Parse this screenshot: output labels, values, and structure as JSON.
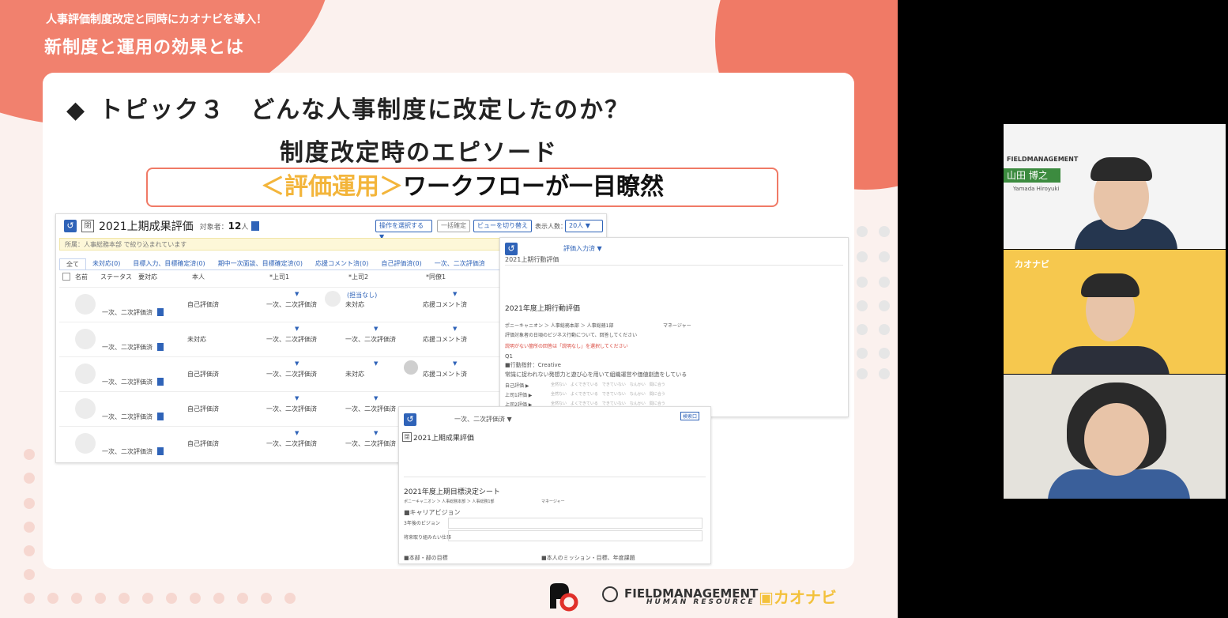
{
  "slide": {
    "header_sub": "人事評価制度改定と同時にカオナビを導入！",
    "header_title": "新制度と運用の効果とは",
    "topic_marker": "◆",
    "topic_title": "トピック３　どんな人事制度に改定したのか？",
    "topic_subtitle": "制度改定時のエピソード",
    "banner_highlight": "＜評価運用＞",
    "banner_text": "ワークフローが一目瞭然"
  },
  "screenshot_main": {
    "kanji": "閉",
    "title": "2021上期成果評価",
    "count_label": "対象者：",
    "count_value": "12",
    "count_unit": "人",
    "operation_select": "操作を選択する",
    "bulk_confirm": "一括確定",
    "view_switch": "ビューを切り替え",
    "display_count_label": "表示人数：",
    "display_count_value": "20人",
    "filter_text": "所属：人事総務本部 で絞り込まれています",
    "tabs": [
      "全て",
      "未対応(0)",
      "目標入力、目標確定済(0)",
      "期中一次面談、目標確定済(0)",
      "応援コメント済(0)",
      "自己評価済(0)",
      "一次、二次評価済"
    ],
    "headers": [
      "名前",
      "ステータス",
      "要対応",
      "本人",
      "*上司1",
      "*上司2",
      "*同僚1"
    ],
    "rows": [
      {
        "status": "一次、二次評価済",
        "self": "自己評価済",
        "boss1": "一次、二次評価済",
        "boss2_a": "(担当なし)",
        "boss2_b": "未対応",
        "peer": "応援コメント済"
      },
      {
        "status": "一次、二次評価済",
        "self": "未対応",
        "boss1": "一次、二次評価済",
        "boss2": "一次、二次評価済",
        "peer": "応援コメント済"
      },
      {
        "status": "一次、二次評価済",
        "self": "自己評価済",
        "boss1": "一次、二次評価済",
        "boss2": "未対応",
        "peer": "応援コメント済"
      },
      {
        "status": "一次、二次評価済",
        "self": "自己評価済",
        "boss1": "一次、二次評価済",
        "boss2": "一次、二次評価済",
        "peer": ""
      },
      {
        "status": "一次、二次評価済",
        "self": "自己評価済",
        "boss1": "一次、二次評価済",
        "boss2": "一次、二次評価済",
        "peer": ""
      }
    ]
  },
  "screenshot_behavior": {
    "status": "評価入力済",
    "sheet_label": "2021上期行動評価",
    "section_title": "2021年度上期行動評価",
    "org": "ポニーキャニオン ＞ 人事総務本部 ＞ 人事総務1部",
    "position": "マネージャー",
    "instruction": "評価対象者の日頃のビジネス行動について、回答してください",
    "red_note": "説明がない箇所の回答は「説明なし」を選択してください",
    "q_label": "Q1",
    "q_item": "■行動指針：Creative",
    "q_text": "常識に捉われない発想力と遊び心を用いて組織運営や価値創造をしている",
    "raters": [
      "自己評価 ▶",
      "上司1評価 ▶",
      "上司2評価 ▶"
    ],
    "options": "全然ない　よくできている　できていない　なんかい　間に合う"
  },
  "screenshot_goal": {
    "status": "一次、二次評価済",
    "kanji": "閉",
    "title": "2021上期成果評価",
    "section_title": "2021年度上期目標決定シート",
    "org": "ポニーキャニオン ＞ 人事総務本部 ＞ 人事総務1部",
    "position": "マネージャー",
    "career": "■キャリアビジョン",
    "vision_3y": "3年後のビジョン",
    "work_want": "将来取り組みたい仕事",
    "dept_goal": "■本部・部の目標",
    "own_mission": "■本人のミッション・目標、年度課題",
    "button": "検索口"
  },
  "footer": {
    "fm_main": "FIELDMANAGEMENT",
    "fm_sub": "HUMAN RESOURCE",
    "kaonavi": "カオナビ"
  },
  "video": {
    "tile1_company": "FIELDMANAGEMENT",
    "tile1_name": "山田 博之",
    "tile1_romaji": "Yamada Hiroyuki",
    "tile2_brand": "カオナビ"
  },
  "colors": {
    "accent_coral": "#f07a66",
    "accent_yellow": "#f3b53b",
    "ui_blue": "#2f63b8",
    "nameplate_green": "#3c8b3f"
  }
}
